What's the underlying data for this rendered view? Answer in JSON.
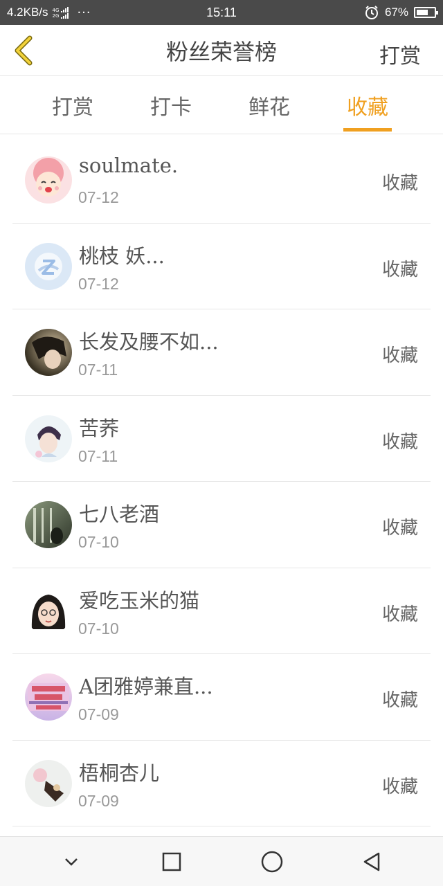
{
  "status_bar": {
    "speed": "4.2KB/s",
    "network_labels": [
      "4G",
      "2G"
    ],
    "more_dots": "···",
    "time": "15:11",
    "battery_percent": "67%",
    "battery_level": 0.67
  },
  "header": {
    "title": "粉丝荣誉榜",
    "action": "打赏",
    "accent_color": "#f0a020"
  },
  "tabs": [
    {
      "label": "打赏",
      "active": false
    },
    {
      "label": "打卡",
      "active": false
    },
    {
      "label": "鲜花",
      "active": false
    },
    {
      "label": "收藏",
      "active": true
    }
  ],
  "items": [
    {
      "name": "soulmate.",
      "date": "07-12",
      "action": "收藏",
      "avatar": "anime-avatar"
    },
    {
      "name": "桃枝 妖...",
      "date": "07-12",
      "action": "收藏",
      "avatar": "default-qzone-avatar"
    },
    {
      "name": "长发及腰不如...",
      "date": "07-11",
      "action": "收藏",
      "avatar": "photo-avatar"
    },
    {
      "name": "苦荞",
      "date": "07-11",
      "action": "收藏",
      "avatar": "photo-avatar"
    },
    {
      "name": "七八老酒",
      "date": "07-10",
      "action": "收藏",
      "avatar": "photo-avatar"
    },
    {
      "name": "爱吃玉米的猫",
      "date": "07-10",
      "action": "收藏",
      "avatar": "cartoon-girl-avatar"
    },
    {
      "name": "A团雅婷兼直...",
      "date": "07-09",
      "action": "收藏",
      "avatar": "text-banner-avatar"
    },
    {
      "name": "梧桐杏儿",
      "date": "07-09",
      "action": "收藏",
      "avatar": "photo-avatar"
    }
  ],
  "nav_bar": {
    "buttons": [
      "chevron-down-icon",
      "recents-square-icon",
      "home-circle-icon",
      "back-triangle-icon"
    ]
  }
}
